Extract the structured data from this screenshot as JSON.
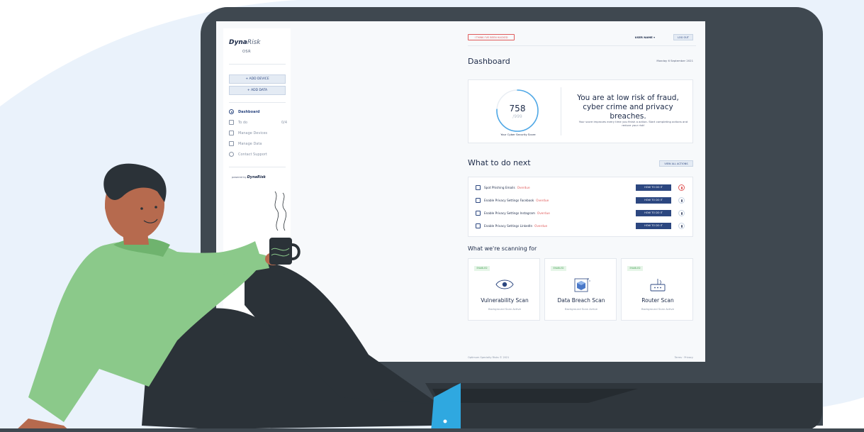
{
  "colors": {
    "navy": "#1c2a48",
    "primary": "#2c4780",
    "overdue": "#e05c5c",
    "enabled_green": "#4ea75c",
    "monitor": "#3f4850"
  },
  "sidebar": {
    "brand": "DynaRisk",
    "brand_strong": "Dyna",
    "brand_light": "Risk",
    "sub_brand": "OSR",
    "add_device_label": "+ ADD DEVICE",
    "add_data_label": "+ ADD DATA",
    "nav": [
      {
        "label": "Dashboard",
        "icon": "radio-icon"
      },
      {
        "label": "To do",
        "count": "0/4",
        "icon": "checkbox-icon"
      },
      {
        "label": "Manage Devices",
        "icon": "devices-icon"
      },
      {
        "label": "Manage Data",
        "icon": "id-card-icon"
      },
      {
        "label": "Contact Support",
        "icon": "chat-icon"
      }
    ],
    "powered_by_prefix": "powered by",
    "powered_by_brand": "DynaRisk"
  },
  "header": {
    "hacked_button": "I THINK I'VE BEEN HACKED",
    "user_name": "USER NAME",
    "logout": "LOG OUT"
  },
  "dashboard": {
    "title": "Dashboard",
    "date": "Monday 6 September 2021"
  },
  "score": {
    "value": "758",
    "max": "/999",
    "caption": "Your Cyber Security Score",
    "fraction": 0.759,
    "headline": "You are at low risk of fraud, cyber crime and privacy breaches.",
    "subtext": "Your score improves every time you finish a action. Start completing actions and reduce your risk!"
  },
  "actions": {
    "title": "What to do next",
    "view_all": "VIEW ALL ACTIONS",
    "how_to_label": "HOW TO DO IT",
    "items": [
      {
        "label": "Spot Phishing Emails",
        "status": "Overdue"
      },
      {
        "label": "Enable Privacy Settings Facebook",
        "status": "Overdue"
      },
      {
        "label": "Enable Privacy Settings Instagram",
        "status": "Overdue"
      },
      {
        "label": "Enable Privacy Settings LinkedIn",
        "status": "Overdue"
      }
    ]
  },
  "scanning": {
    "title": "What we're scanning for",
    "items": [
      {
        "badge": "ENABLED",
        "title": "Vulnerability Scan",
        "subtitle": "Background Scan Active",
        "icon": "eye-icon"
      },
      {
        "badge": "ENABLED",
        "title": "Data Breach Scan",
        "subtitle": "Background Scan Active",
        "icon": "cube-icon"
      },
      {
        "badge": "ENABLED",
        "title": "Router Scan",
        "subtitle": "Background Scan Active",
        "icon": "router-icon"
      }
    ]
  },
  "footer": {
    "copyright": "Optimum Specialty Risks © 2021",
    "links": "Terms · Privacy"
  }
}
